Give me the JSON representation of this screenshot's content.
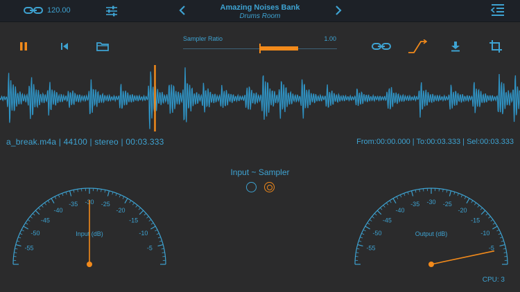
{
  "topbar": {
    "bpm_value": "120.00",
    "bank_title": "Amazing Noises Bank",
    "bank_subtitle": "Drums Room"
  },
  "toolbar": {
    "sampler_ratio_label": "Sampler Ratio",
    "sampler_ratio_value": "1.00",
    "sampler_ratio_level": 0.28
  },
  "file": {
    "info": "a_break.m4a | 44100 | stereo  | 00:03.333",
    "range": "From:00:00.000 | To:00:03.333 | Sel:00:03.333",
    "playhead_fraction": 0.298
  },
  "mode": {
    "label": "Input ~ Sampler",
    "options": [
      "Input",
      "Sampler"
    ],
    "selected": "Sampler"
  },
  "meters": [
    {
      "name": "input",
      "label": "Input (dB)",
      "ticks": [
        "-55",
        "-50",
        "-45",
        "-40",
        "-35",
        "-30",
        "-25",
        "-20",
        "-15",
        "-10",
        "-5"
      ],
      "needle_db": -30
    },
    {
      "name": "output",
      "label": "Output (dB)",
      "ticks": [
        "-55",
        "-50",
        "-45",
        "-40",
        "-35",
        "-30",
        "-25",
        "-20",
        "-15",
        "-10",
        "-5"
      ],
      "needle_db": -4
    }
  ],
  "status": {
    "cpu": "CPU: 3"
  },
  "colors": {
    "accent_blue": "#3ea3d2",
    "accent_orange": "#f28a1b",
    "background": "#2b2b2c",
    "topbar": "#1d2127"
  },
  "icons": {
    "topbar": [
      "link-icon",
      "sliders-icon",
      "chevron-left-icon",
      "chevron-right-icon",
      "list-indent-icon"
    ],
    "toolbar": [
      "pause-icon",
      "skip-back-icon",
      "folder-icon",
      "link-icon",
      "curve-icon",
      "download-icon",
      "crop-icon"
    ]
  }
}
